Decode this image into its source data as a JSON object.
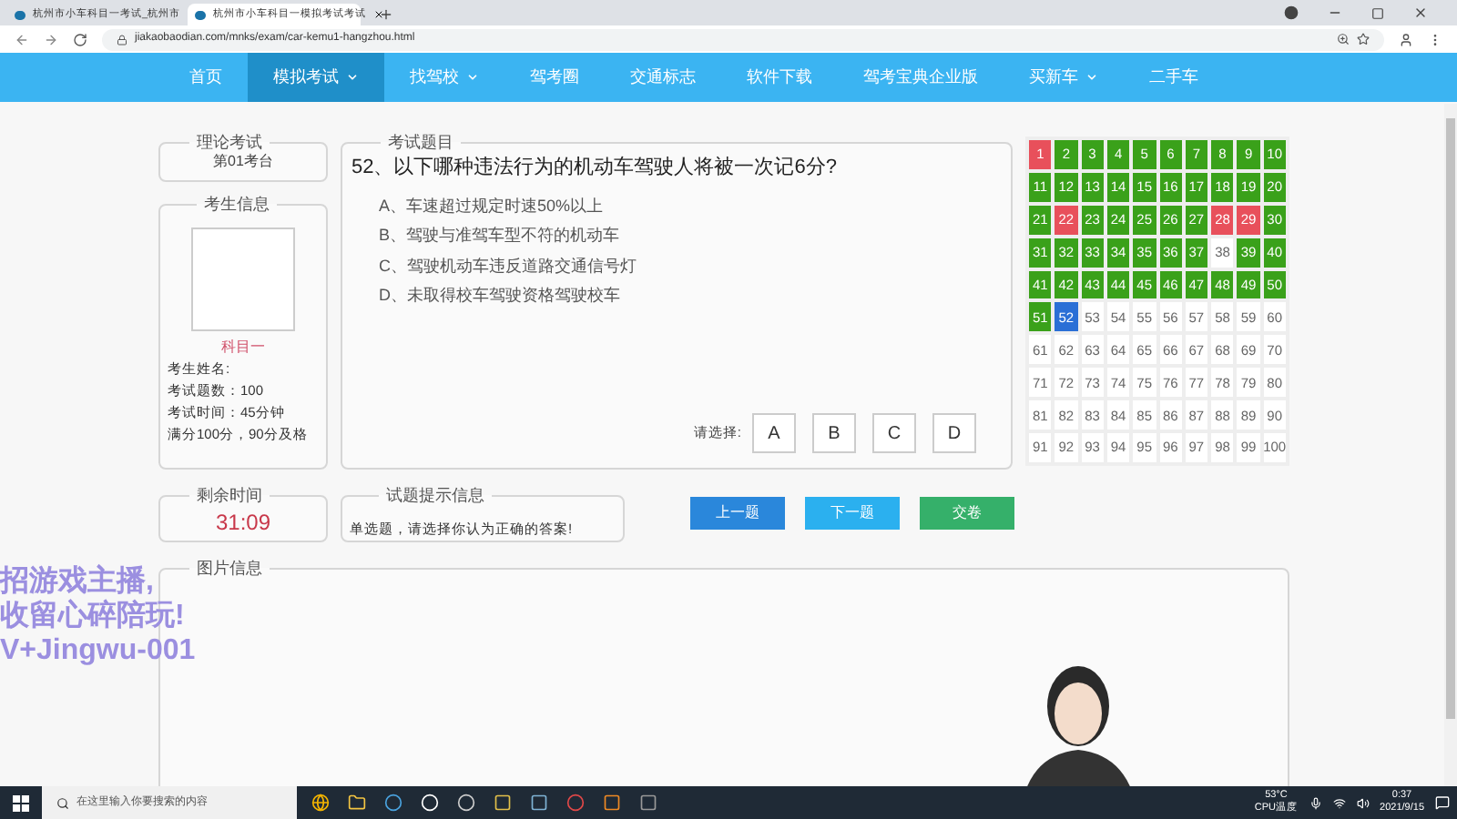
{
  "browser": {
    "tabs": [
      {
        "title": "杭州市小车科目一考试_杭州市",
        "selected": false
      },
      {
        "title": "杭州市小车科目一模拟考试考试",
        "selected": true
      }
    ],
    "url": "jiakaobaodian.com/mnks/exam/car-kemu1-hangzhou.html"
  },
  "nav": [
    {
      "label": "首页",
      "selected": false,
      "has_menu": false
    },
    {
      "label": "模拟考试",
      "selected": true,
      "has_menu": true
    },
    {
      "label": "找驾校",
      "selected": false,
      "has_menu": true
    },
    {
      "label": "驾考圈",
      "selected": false,
      "has_menu": false
    },
    {
      "label": "交通标志",
      "selected": false,
      "has_menu": false
    },
    {
      "label": "软件下载",
      "selected": false,
      "has_menu": false
    },
    {
      "label": "驾考宝典企业版",
      "selected": false,
      "has_menu": false
    },
    {
      "label": "买新车",
      "selected": false,
      "has_menu": true
    },
    {
      "label": "二手车",
      "selected": false,
      "has_menu": false
    }
  ],
  "exam": {
    "title": "理论考试",
    "seat": "第01考台"
  },
  "candidate": {
    "title": "考生信息",
    "subject": "科目一",
    "lines": [
      "考生姓名:",
      "考试题数：100",
      "考试时间：45分钟",
      "满分100分，90分及格"
    ]
  },
  "question": {
    "title": "考试题目",
    "text": "52、以下哪种违法行为的机动车驾驶人将被一次记6分?",
    "options": [
      "A、车速超过规定时速50%以上",
      "B、驾驶与准驾车型不符的机动车",
      "C、驾驶机动车违反道路交通信号灯",
      "D、未取得校车驾驶资格驾驶校车"
    ],
    "choose_label": "请选择:",
    "answers": [
      {
        "label": "A",
        "selected": false
      },
      {
        "label": "B",
        "selected": false
      },
      {
        "label": "C",
        "selected": false
      },
      {
        "label": "D",
        "selected": false
      }
    ]
  },
  "grid": {
    "cells": [
      {
        "label": "1",
        "color": "#e8505b"
      },
      {
        "label": "2",
        "color": "#3aa11a"
      },
      {
        "label": "3",
        "color": "#3aa11a"
      },
      {
        "label": "4",
        "color": "#3aa11a"
      },
      {
        "label": "5",
        "color": "#3aa11a"
      },
      {
        "label": "6",
        "color": "#3aa11a"
      },
      {
        "label": "7",
        "color": "#3aa11a"
      },
      {
        "label": "8",
        "color": "#3aa11a"
      },
      {
        "label": "9",
        "color": "#3aa11a"
      },
      {
        "label": "10",
        "color": "#3aa11a"
      },
      {
        "label": "11",
        "color": "#3aa11a"
      },
      {
        "label": "12",
        "color": "#3aa11a"
      },
      {
        "label": "13",
        "color": "#3aa11a"
      },
      {
        "label": "14",
        "color": "#3aa11a"
      },
      {
        "label": "15",
        "color": "#3aa11a"
      },
      {
        "label": "16",
        "color": "#3aa11a"
      },
      {
        "label": "17",
        "color": "#3aa11a"
      },
      {
        "label": "18",
        "color": "#3aa11a"
      },
      {
        "label": "19",
        "color": "#3aa11a"
      },
      {
        "label": "20",
        "color": "#3aa11a"
      },
      {
        "label": "21",
        "color": "#3aa11a"
      },
      {
        "label": "22",
        "color": "#e8505b"
      },
      {
        "label": "23",
        "color": "#3aa11a"
      },
      {
        "label": "24",
        "color": "#3aa11a"
      },
      {
        "label": "25",
        "color": "#3aa11a"
      },
      {
        "label": "26",
        "color": "#3aa11a"
      },
      {
        "label": "27",
        "color": "#3aa11a"
      },
      {
        "label": "28",
        "color": "#e8505b"
      },
      {
        "label": "29",
        "color": "#e8505b"
      },
      {
        "label": "30",
        "color": "#3aa11a"
      },
      {
        "label": "31",
        "color": "#3aa11a"
      },
      {
        "label": "32",
        "color": "#3aa11a"
      },
      {
        "label": "33",
        "color": "#3aa11a"
      },
      {
        "label": "34",
        "color": "#3aa11a"
      },
      {
        "label": "35",
        "color": "#3aa11a"
      },
      {
        "label": "36",
        "color": "#3aa11a"
      },
      {
        "label": "37",
        "color": "#3aa11a"
      },
      {
        "label": "38",
        "color": "#ffffff"
      },
      {
        "label": "39",
        "color": "#3aa11a"
      },
      {
        "label": "40",
        "color": "#3aa11a"
      },
      {
        "label": "41",
        "color": "#3aa11a"
      },
      {
        "label": "42",
        "color": "#3aa11a"
      },
      {
        "label": "43",
        "color": "#3aa11a"
      },
      {
        "label": "44",
        "color": "#3aa11a"
      },
      {
        "label": "45",
        "color": "#3aa11a"
      },
      {
        "label": "46",
        "color": "#3aa11a"
      },
      {
        "label": "47",
        "color": "#3aa11a"
      },
      {
        "label": "48",
        "color": "#3aa11a"
      },
      {
        "label": "49",
        "color": "#3aa11a"
      },
      {
        "label": "50",
        "color": "#3aa11a"
      },
      {
        "label": "51",
        "color": "#3aa11a"
      },
      {
        "label": "52",
        "color": "#2a6fd6"
      },
      {
        "label": "53",
        "color": "#ffffff"
      },
      {
        "label": "54",
        "color": "#ffffff"
      },
      {
        "label": "55",
        "color": "#ffffff"
      },
      {
        "label": "56",
        "color": "#ffffff"
      },
      {
        "label": "57",
        "color": "#ffffff"
      },
      {
        "label": "58",
        "color": "#ffffff"
      },
      {
        "label": "59",
        "color": "#ffffff"
      },
      {
        "label": "60",
        "color": "#ffffff"
      },
      {
        "label": "61",
        "color": "#ffffff"
      },
      {
        "label": "62",
        "color": "#ffffff"
      },
      {
        "label": "63",
        "color": "#ffffff"
      },
      {
        "label": "64",
        "color": "#ffffff"
      },
      {
        "label": "65",
        "color": "#ffffff"
      },
      {
        "label": "66",
        "color": "#ffffff"
      },
      {
        "label": "67",
        "color": "#ffffff"
      },
      {
        "label": "68",
        "color": "#ffffff"
      },
      {
        "label": "69",
        "color": "#ffffff"
      },
      {
        "label": "70",
        "color": "#ffffff"
      },
      {
        "label": "71",
        "color": "#ffffff"
      },
      {
        "label": "72",
        "color": "#ffffff"
      },
      {
        "label": "73",
        "color": "#ffffff"
      },
      {
        "label": "74",
        "color": "#ffffff"
      },
      {
        "label": "75",
        "color": "#ffffff"
      },
      {
        "label": "76",
        "color": "#ffffff"
      },
      {
        "label": "77",
        "color": "#ffffff"
      },
      {
        "label": "78",
        "color": "#ffffff"
      },
      {
        "label": "79",
        "color": "#ffffff"
      },
      {
        "label": "80",
        "color": "#ffffff"
      },
      {
        "label": "81",
        "color": "#ffffff"
      },
      {
        "label": "82",
        "color": "#ffffff"
      },
      {
        "label": "83",
        "color": "#ffffff"
      },
      {
        "label": "84",
        "color": "#ffffff"
      },
      {
        "label": "85",
        "color": "#ffffff"
      },
      {
        "label": "86",
        "color": "#ffffff"
      },
      {
        "label": "87",
        "color": "#ffffff"
      },
      {
        "label": "88",
        "color": "#ffffff"
      },
      {
        "label": "89",
        "color": "#ffffff"
      },
      {
        "label": "90",
        "color": "#ffffff"
      },
      {
        "label": "91",
        "color": "#ffffff"
      },
      {
        "label": "92",
        "color": "#ffffff"
      },
      {
        "label": "93",
        "color": "#ffffff"
      },
      {
        "label": "94",
        "color": "#ffffff"
      },
      {
        "label": "95",
        "color": "#ffffff"
      },
      {
        "label": "96",
        "color": "#ffffff"
      },
      {
        "label": "97",
        "color": "#ffffff"
      },
      {
        "label": "98",
        "color": "#ffffff"
      },
      {
        "label": "99",
        "color": "#ffffff"
      },
      {
        "label": "100",
        "color": "#ffffff"
      }
    ]
  },
  "timer": {
    "title": "剩余时间",
    "value": "31:09"
  },
  "hint": {
    "title": "试题提示信息",
    "text": "单选题，请选择你认为正确的答案!"
  },
  "buttons": [
    {
      "label": "上一题",
      "kind": "prev"
    },
    {
      "label": "下一题",
      "kind": "next"
    },
    {
      "label": "交卷",
      "kind": "submit"
    }
  ],
  "picture": {
    "title": "图片信息"
  },
  "overlay": [
    "招游戏主播,",
    "收留心碎陪玩!",
    "V+Jingwu-001"
  ],
  "taskbar": {
    "search_placeholder": "在这里输入你要搜索的内容",
    "temp": "53°C",
    "temp_label": "CPU温度",
    "time": "0:37",
    "date": "2021/9/15"
  }
}
